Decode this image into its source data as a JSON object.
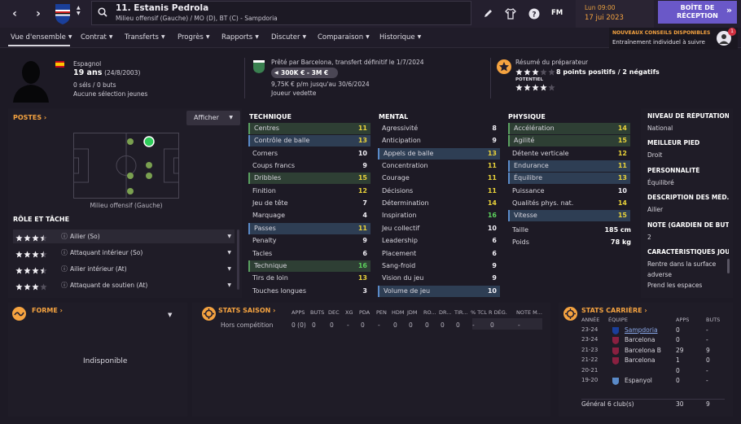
{
  "topbar": {
    "player_title": "11. Estanis Pedrola",
    "player_subtitle": "Milieu offensif (Gauche) / MO (D), BT (C) - Sampdoria",
    "time": "Lun 09:00",
    "date": "17 jui 2023",
    "fm_label": "FM",
    "inbox_line1": "BOÎTE DE",
    "inbox_line2": "RÉCEPTION"
  },
  "notification": {
    "title": "NOUVEAUX CONSEILS DISPONIBLES",
    "text": "Entraînement individuel à suivre",
    "badge": "1"
  },
  "menu": [
    {
      "label": "Vue d'ensemble"
    },
    {
      "label": "Contrat"
    },
    {
      "label": "Transferts"
    },
    {
      "label": "Progrès"
    },
    {
      "label": "Rapports"
    },
    {
      "label": "Discuter"
    },
    {
      "label": "Comparaison"
    },
    {
      "label": "Historique"
    }
  ],
  "header": {
    "nationality": "Espagnol",
    "age": "19 ans",
    "dob": "(24/8/2003)",
    "caps": "0 séls / 0 buts",
    "youth": "Aucune sélection jeunes",
    "loan": "Prêté par Barcelona, transfert définitif le 1/7/2024",
    "value": "300K € - 3M €",
    "wage": "9,75K € p/m jusqu'au 30/6/2024",
    "status": "Joueur vedette",
    "coach_title": "Résumé du préparateur",
    "coach_points": "8 points positifs / 2 négatifs",
    "potential_label": "POTENTIEL",
    "current_stars": 3,
    "potential_stars": 4
  },
  "positions": {
    "title": "POSTES",
    "button": "Afficher",
    "pitch_label": "Milieu offensif (Gauche)"
  },
  "roles": {
    "title": "RÔLE ET TÂCHE",
    "items": [
      {
        "label": "Ailier (So)",
        "stars": 3.5
      },
      {
        "label": "Attaquant intérieur (So)",
        "stars": 3.5
      },
      {
        "label": "Ailier intérieur (At)",
        "stars": 3.5
      },
      {
        "label": "Attaquant de soutien (At)",
        "stars": 3
      }
    ]
  },
  "technique": {
    "title": "TECHNIQUE",
    "rows": [
      {
        "label": "Centres",
        "value": "11",
        "hl": "green",
        "col": "yellow"
      },
      {
        "label": "Contrôle de balle",
        "value": "13",
        "hl": "blue",
        "col": "yellow"
      },
      {
        "label": "Corners",
        "value": "10",
        "hl": "",
        "col": "white"
      },
      {
        "label": "Coups francs",
        "value": "9",
        "hl": "",
        "col": "white"
      },
      {
        "label": "Dribbles",
        "value": "15",
        "hl": "green",
        "col": "yellow"
      },
      {
        "label": "Finition",
        "value": "12",
        "hl": "",
        "col": "yellow"
      },
      {
        "label": "Jeu de tête",
        "value": "7",
        "hl": "",
        "col": "white"
      },
      {
        "label": "Marquage",
        "value": "4",
        "hl": "",
        "col": "white"
      },
      {
        "label": "Passes",
        "value": "11",
        "hl": "blue",
        "col": "yellow"
      },
      {
        "label": "Penalty",
        "value": "9",
        "hl": "",
        "col": "white"
      },
      {
        "label": "Tacles",
        "value": "6",
        "hl": "",
        "col": "white"
      },
      {
        "label": "Technique",
        "value": "16",
        "hl": "green",
        "col": "green"
      },
      {
        "label": "Tirs de loin",
        "value": "13",
        "hl": "",
        "col": "yellow"
      },
      {
        "label": "Touches longues",
        "value": "3",
        "hl": "",
        "col": "white"
      }
    ]
  },
  "mental": {
    "title": "MENTAL",
    "rows": [
      {
        "label": "Agressivité",
        "value": "8",
        "hl": "",
        "col": "white"
      },
      {
        "label": "Anticipation",
        "value": "9",
        "hl": "",
        "col": "white"
      },
      {
        "label": "Appels de balle",
        "value": "13",
        "hl": "blue",
        "col": "yellow"
      },
      {
        "label": "Concentration",
        "value": "11",
        "hl": "",
        "col": "yellow"
      },
      {
        "label": "Courage",
        "value": "11",
        "hl": "",
        "col": "yellow"
      },
      {
        "label": "Décisions",
        "value": "11",
        "hl": "",
        "col": "yellow"
      },
      {
        "label": "Détermination",
        "value": "14",
        "hl": "",
        "col": "yellow"
      },
      {
        "label": "Inspiration",
        "value": "16",
        "hl": "",
        "col": "green"
      },
      {
        "label": "Jeu collectif",
        "value": "10",
        "hl": "",
        "col": "white"
      },
      {
        "label": "Leadership",
        "value": "6",
        "hl": "",
        "col": "white"
      },
      {
        "label": "Placement",
        "value": "6",
        "hl": "",
        "col": "white"
      },
      {
        "label": "Sang-froid",
        "value": "9",
        "hl": "",
        "col": "white"
      },
      {
        "label": "Vision du jeu",
        "value": "9",
        "hl": "",
        "col": "white"
      },
      {
        "label": "Volume de jeu",
        "value": "10",
        "hl": "blue",
        "col": "white"
      }
    ]
  },
  "physique": {
    "title": "PHYSIQUE",
    "rows": [
      {
        "label": "Accélération",
        "value": "14",
        "hl": "green",
        "col": "yellow"
      },
      {
        "label": "Agilité",
        "value": "15",
        "hl": "green",
        "col": "yellow"
      },
      {
        "label": "Détente verticale",
        "value": "12",
        "hl": "",
        "col": "yellow"
      },
      {
        "label": "Endurance",
        "value": "11",
        "hl": "blue",
        "col": "yellow"
      },
      {
        "label": "Équilibre",
        "value": "13",
        "hl": "blue",
        "col": "yellow"
      },
      {
        "label": "Puissance",
        "value": "10",
        "hl": "",
        "col": "white"
      },
      {
        "label": "Qualités phys. nat.",
        "value": "14",
        "hl": "",
        "col": "yellow"
      },
      {
        "label": "Vitesse",
        "value": "15",
        "hl": "blue",
        "col": "yellow"
      }
    ],
    "height_label": "Taille",
    "height": "185 cm",
    "weight_label": "Poids",
    "weight": "78 kg"
  },
  "info": [
    {
      "label": "NIVEAU DE RÉPUTATION",
      "value": "National"
    },
    {
      "label": "MEILLEUR PIED",
      "value": "Droit"
    },
    {
      "label": "PERSONNALITÉ",
      "value": "Équilibré"
    },
    {
      "label": "DESCRIPTION DES MÉD…",
      "value": "Ailier"
    },
    {
      "label": "NOTE (GARDIEN DE BUT)",
      "value": "2"
    },
    {
      "label": "CARACTÉRISTIQUES JOUI",
      "value": "Rentre dans la surface adverse\nPrend les espaces"
    }
  ],
  "forme": {
    "title": "FORME",
    "status": "Indisponible"
  },
  "season_stats": {
    "title": "STATS SAISON",
    "columns": [
      "APPS",
      "BUTS",
      "DEC",
      "XG",
      "PDA",
      "PEN",
      "HDM",
      "JDM",
      "RO...",
      "DR...",
      "TIR...",
      "% TCL",
      "R DÉG.",
      "NOTE M..."
    ],
    "row_label": "Hors compétition",
    "row": [
      "0 (0)",
      "0",
      "0",
      "-",
      "0",
      "-",
      "0",
      "0",
      "0",
      "0",
      "0",
      "-",
      "0",
      "-"
    ]
  },
  "career": {
    "title": "STATS CARRIÈRE",
    "columns": [
      "ANNÉE",
      "ÉQUIPE",
      "APPS",
      "BUTS"
    ],
    "rows": [
      {
        "year": "23-24",
        "team": "Sampdoria",
        "apps": "0",
        "goals": "-",
        "link": true
      },
      {
        "year": "23-24",
        "team": "Barcelona",
        "apps": "0",
        "goals": "-",
        "link": false
      },
      {
        "year": "21-23",
        "team": "Barcelona B",
        "apps": "29",
        "goals": "9",
        "link": false
      },
      {
        "year": "21-22",
        "team": "Barcelona",
        "apps": "1",
        "goals": "0",
        "link": false
      },
      {
        "year": "20-21",
        "team": "",
        "apps": "0",
        "goals": "-",
        "link": false
      },
      {
        "year": "19-20",
        "team": "Espanyol",
        "apps": "0",
        "goals": "-",
        "link": false
      }
    ],
    "total_label": "Général 6 club(s)",
    "total_apps": "30",
    "total_goals": "9"
  }
}
